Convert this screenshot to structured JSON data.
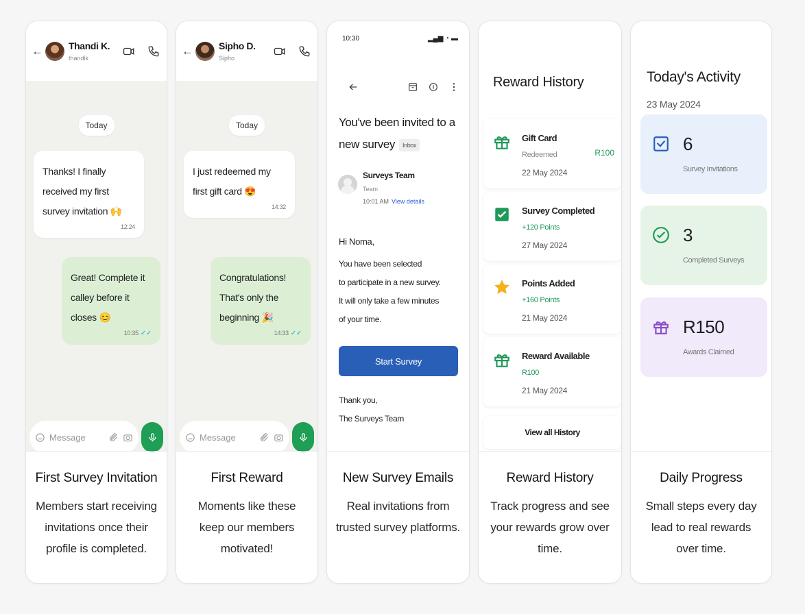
{
  "panels": {
    "chat1": {
      "contact_name": "Thandi K.",
      "contact_sub": "thandik",
      "day_label": "Today",
      "incoming_text": "Thanks! I finally received my first survey invitation 🙌",
      "incoming_time": "12:24",
      "outgoing_text": "Great! Complete it calley before it closes 😊",
      "outgoing_time": "10:35",
      "composer_placeholder": "Message",
      "caption_title": "First Survey Invitation",
      "caption_text": "Members start receiving invitations once their profile is completed."
    },
    "chat2": {
      "contact_name": "Sipho D.",
      "contact_sub": "Sipho",
      "day_label": "Today",
      "incoming_text": "I just redeemed my first gift card 😍",
      "incoming_time": "14:32",
      "outgoing_text": "Congratulations! That's only the beginning 🎉",
      "outgoing_time": "14:33",
      "composer_placeholder": "Message",
      "caption_title": "First Reward",
      "caption_text": "Moments like these keep our members motivated!"
    },
    "email": {
      "status_time": "10:30",
      "subject": "You've been invited to a new survey",
      "inbox_tag": "Inbox",
      "sender_name": "Surveys Team",
      "sender_role": "Team",
      "sent_time": "10:01 AM",
      "view_details": "View details",
      "greeting": "Hi Noma,",
      "body_lines": [
        "You have been selected",
        "to participate in a new survey.",
        "It will only take a few minutes",
        "of your time."
      ],
      "button_label": "Start Survey",
      "signoff_lines": [
        "Thank you,",
        "The Surveys Team"
      ],
      "caption_title": "New Survey Emails",
      "caption_text": "Real invitations from trusted survey platforms."
    },
    "history": {
      "title": "Reward History",
      "items": [
        {
          "title": "Gift Card",
          "status": "Redeemed",
          "date": "22 May 2024",
          "amount": "R100",
          "icon": "gift-icon",
          "color": "#1f9a5a"
        },
        {
          "title": "Survey Completed",
          "status": "+120 Points",
          "date": "27 May 2024",
          "amount": "",
          "icon": "check-square-icon",
          "color": "#1f9a5a"
        },
        {
          "title": "Points Added",
          "status": "+160 Points",
          "date": "21 May 2024",
          "amount": "",
          "icon": "star-icon",
          "color": "#f2b21c"
        },
        {
          "title": "Reward Available",
          "status": "R100",
          "date": "21 May 2024",
          "amount": "",
          "icon": "gift-icon",
          "color": "#1f9a5a"
        }
      ],
      "view_all": "View all History",
      "caption_title": "Reward History",
      "caption_text": "Track progress and see your rewards grow over time."
    },
    "activity": {
      "title": "Today's Activity",
      "date": "23 May 2024",
      "stats": [
        {
          "value": "6",
          "label": "Survey Invitations",
          "icon": "checkbox-icon",
          "bg": "#e7f0fb",
          "color": "#2a5fb7"
        },
        {
          "value": "3",
          "label": "Completed Surveys",
          "icon": "check-circle-icon",
          "bg": "#e6f4e8",
          "color": "#1f9a5a"
        },
        {
          "value": "R150",
          "label": "Awards Claimed",
          "icon": "gift-icon",
          "bg": "#f1eafa",
          "color": "#8a4fc9"
        }
      ],
      "caption_title": "Daily Progress",
      "caption_text": "Small steps every day lead to real rewards over time."
    }
  }
}
